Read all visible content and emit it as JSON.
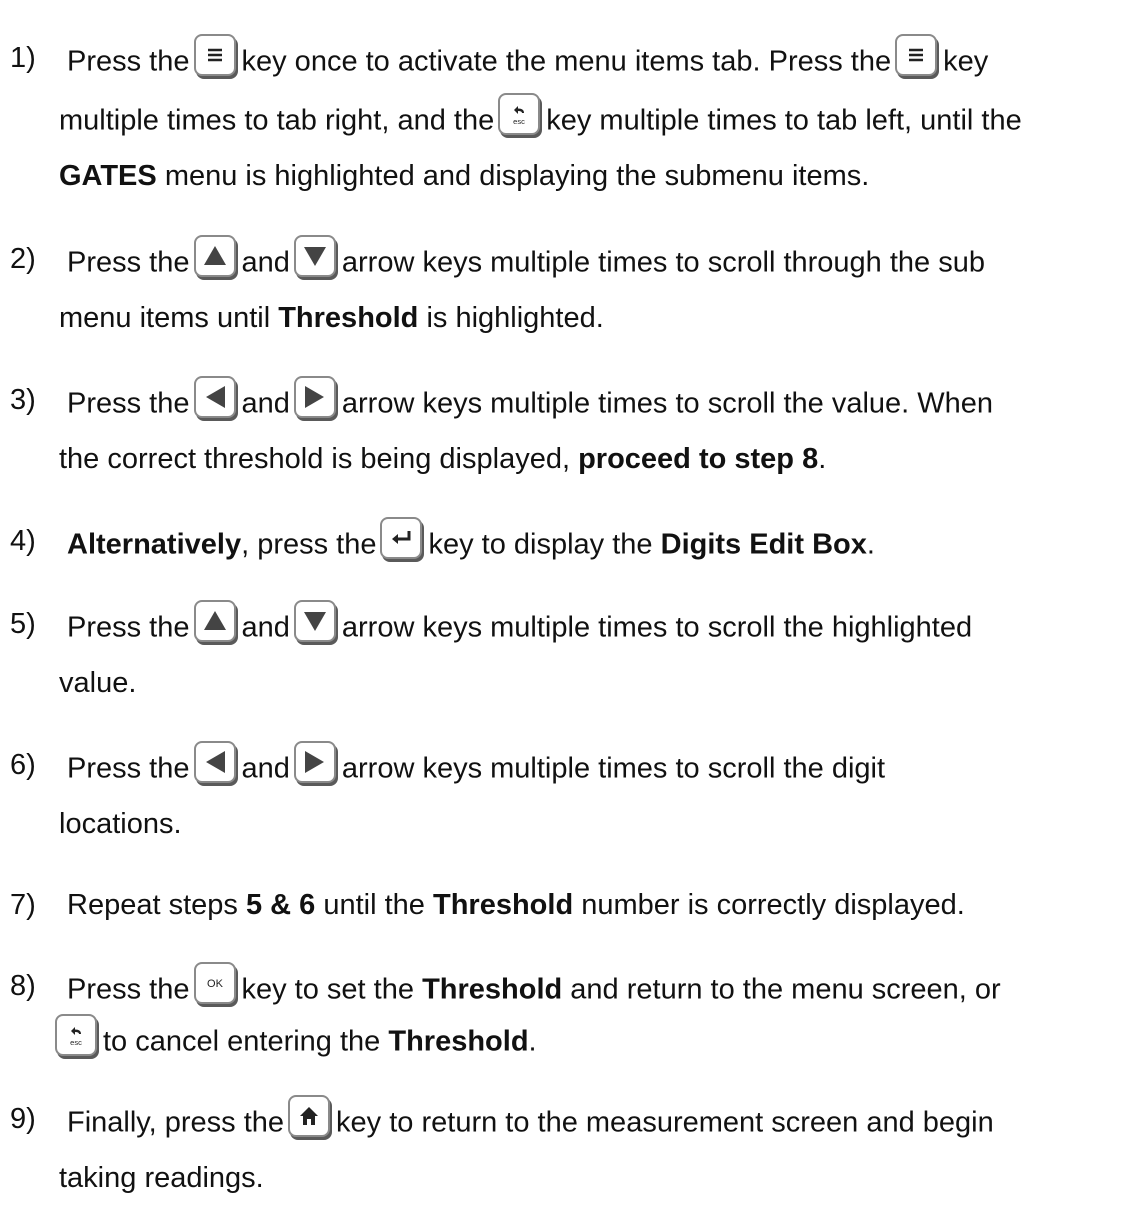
{
  "steps": [
    {
      "num": "1)",
      "l1": [
        "Press the",
        "key once to activate the menu items tab.  Press the",
        "key"
      ],
      "l2": [
        "multiple times to tab right, and the",
        "key multiple times to tab left, until the"
      ],
      "l3": [
        "GATES",
        "menu is highlighted and displaying the submenu items."
      ]
    },
    {
      "num": "2)",
      "l1": [
        "Press the",
        "and",
        "arrow keys multiple times to scroll through the sub"
      ],
      "l2": [
        "menu items until",
        "Threshold",
        "is highlighted."
      ]
    },
    {
      "num": "3)",
      "l1": [
        "Press the",
        "and",
        "arrow keys multiple times to scroll the value.  When"
      ],
      "l2": [
        "the correct threshold is being displayed,",
        "proceed to step 8",
        "."
      ]
    },
    {
      "num": "4)",
      "l1": [
        "Alternatively",
        ", press the",
        "key to display the",
        "Digits Edit Box",
        "."
      ]
    },
    {
      "num": "5)",
      "l1": [
        "Press the",
        "and",
        "arrow keys multiple times to scroll the highlighted"
      ],
      "l2": [
        "value."
      ]
    },
    {
      "num": "6)",
      "l1": [
        "Press the",
        "and",
        "arrow keys multiple times to scroll the digit"
      ],
      "l2": [
        "locations."
      ]
    },
    {
      "num": "7)",
      "l1": [
        "Repeat steps",
        "5 & 6",
        "until the",
        "Threshold",
        "number is correctly displayed."
      ]
    },
    {
      "num": "8)",
      "l1": [
        "Press the",
        "key to set the",
        "Threshold",
        "and return to the menu screen, or"
      ],
      "l2": [
        "to cancel entering the",
        "Threshold",
        "."
      ]
    },
    {
      "num": "9)",
      "l1": [
        "Finally, press the",
        "key to return to the measurement screen and begin"
      ],
      "l2": [
        "taking readings."
      ]
    }
  ],
  "keys": {
    "menu": "menu-icon",
    "esc": "esc",
    "up": "up-arrow-icon",
    "down": "down-arrow-icon",
    "left": "left-arrow-icon",
    "right": "right-arrow-icon",
    "enter": "enter-icon",
    "ok": "OK",
    "home": "home-icon"
  }
}
